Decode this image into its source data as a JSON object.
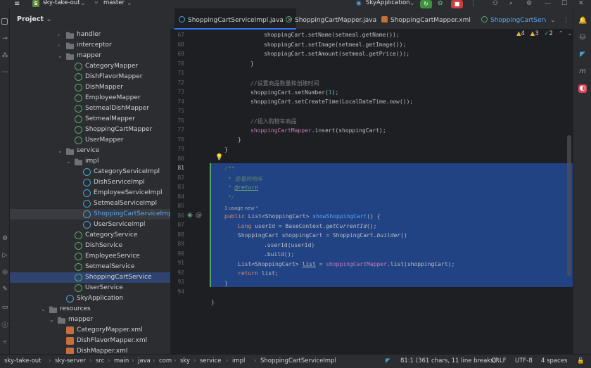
{
  "titlebar": {
    "project_badge": "S",
    "project_name": "sky-take-out",
    "branch": "master",
    "run_config": "SkyApplication"
  },
  "project_panel": {
    "header": "Project",
    "tree": [
      {
        "label": "handler",
        "icon": "folder"
      },
      {
        "label": "interceptor",
        "icon": "folder"
      },
      {
        "label": "mapper",
        "icon": "folder"
      },
      {
        "label": "CategoryMapper",
        "icon": "interface"
      },
      {
        "label": "DishFlavorMapper",
        "icon": "interface"
      },
      {
        "label": "DishMapper",
        "icon": "interface"
      },
      {
        "label": "EmployeeMapper",
        "icon": "interface"
      },
      {
        "label": "SetmealDishMapper",
        "icon": "interface"
      },
      {
        "label": "SetmealMapper",
        "icon": "interface"
      },
      {
        "label": "ShoppingCartMapper",
        "icon": "interface"
      },
      {
        "label": "UserMapper",
        "icon": "interface"
      },
      {
        "label": "service",
        "icon": "folder"
      },
      {
        "label": "impl",
        "icon": "folder"
      },
      {
        "label": "CategoryServiceImpl",
        "icon": "class"
      },
      {
        "label": "DishServiceImpl",
        "icon": "class"
      },
      {
        "label": "EmployeeServiceImpl",
        "icon": "class"
      },
      {
        "label": "SetmealServiceImpl",
        "icon": "class"
      },
      {
        "label": "ShoppingCartServiceImpl",
        "icon": "class"
      },
      {
        "label": "UserServiceImpl",
        "icon": "class"
      },
      {
        "label": "CategoryService",
        "icon": "interface"
      },
      {
        "label": "DishService",
        "icon": "interface"
      },
      {
        "label": "EmployeeService",
        "icon": "interface"
      },
      {
        "label": "SetmealService",
        "icon": "interface"
      },
      {
        "label": "ShoppingCartService",
        "icon": "interface"
      },
      {
        "label": "UserService",
        "icon": "interface"
      },
      {
        "label": "SkyApplication",
        "icon": "app"
      },
      {
        "label": "resources",
        "icon": "folder"
      },
      {
        "label": "mapper",
        "icon": "folder"
      },
      {
        "label": "CategoryMapper.xml",
        "icon": "xml"
      },
      {
        "label": "DishFlavorMapper.xml",
        "icon": "xml"
      },
      {
        "label": "DishMapper.xml",
        "icon": "xml"
      }
    ]
  },
  "tabs": [
    {
      "label": "ShoppingCartServiceImpl.java",
      "active": true
    },
    {
      "label": "ShoppingCartMapper.java",
      "active": false
    },
    {
      "label": "ShoppingCartMapper.xml",
      "active": false
    },
    {
      "label": "ShoppingCartServic",
      "active": false
    }
  ],
  "inspections": {
    "warnings": "4",
    "weak_warnings": "3",
    "typos": "2"
  },
  "editor": {
    "line_numbers": [
      "67",
      "68",
      "69",
      "70",
      "71",
      "72",
      "73",
      "74",
      "75",
      "76",
      "77",
      "78",
      "79",
      "80",
      "81",
      "82",
      "83",
      "84",
      "85",
      "86",
      "87",
      "88",
      "89",
      "90",
      "91",
      "92",
      "93",
      "94"
    ],
    "usage_hint": "1 usage   new *",
    "comment_set_number": "//设置商品数量和创建时间",
    "comment_insert": "//插入购物车商品",
    "javadoc_text": " * 查看购物车"
  },
  "statusbar": {
    "breadcrumbs": [
      "sky-take-out",
      "sky-server",
      "src",
      "main",
      "java",
      "com",
      "sky",
      "service",
      "impl",
      "ShoppingCartServiceImpl"
    ],
    "position": "81:1 (361 chars, 11 line breaks)",
    "line_ending": "CRLF",
    "encoding": "UTF-8",
    "indent": "4 spaces"
  },
  "colors": {
    "selection": "#214283",
    "accent": "#3574f0",
    "keyword": "#cf8e6d",
    "method": "#56a8f5",
    "field": "#c77dbb"
  }
}
